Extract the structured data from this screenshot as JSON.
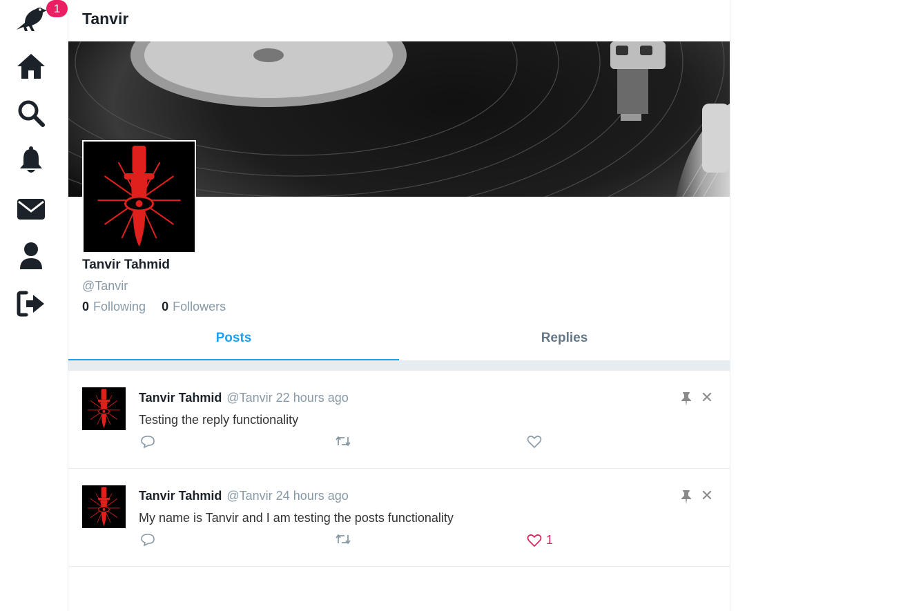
{
  "nav": {
    "notification_count": "1",
    "items": [
      {
        "name": "logo-bird-icon"
      },
      {
        "name": "home-icon"
      },
      {
        "name": "search-icon"
      },
      {
        "name": "notifications-bell-icon"
      },
      {
        "name": "messages-envelope-icon"
      },
      {
        "name": "profile-user-icon"
      },
      {
        "name": "logout-icon"
      }
    ]
  },
  "header": {
    "title": "Tanvir"
  },
  "profile": {
    "display_name": "Tanvir Tahmid",
    "username": "@Tanvir",
    "following_count": "0",
    "following_label": "Following",
    "followers_count": "0",
    "followers_label": "Followers",
    "avatar_icon": "red-dagger-eye-icon",
    "cover_image": "vinyl-record-turntable"
  },
  "tabs": [
    {
      "label": "Posts",
      "active": true
    },
    {
      "label": "Replies",
      "active": false
    }
  ],
  "posts": [
    {
      "display_name": "Tanvir Tahmid",
      "username": "@Tanvir",
      "timestamp": "22 hours ago",
      "content": "Testing the reply functionality",
      "likes": "",
      "liked": false
    },
    {
      "display_name": "Tanvir Tahmid",
      "username": "@Tanvir",
      "timestamp": "24 hours ago",
      "content": "My name is Tanvir and I am testing the posts functionality",
      "likes": "1",
      "liked": true
    }
  ],
  "colors": {
    "accent": "#1da1f2",
    "badge": "#e91e63",
    "like": "#e0245e",
    "muted": "#8899a6",
    "avatar_red": "#e0201c"
  }
}
